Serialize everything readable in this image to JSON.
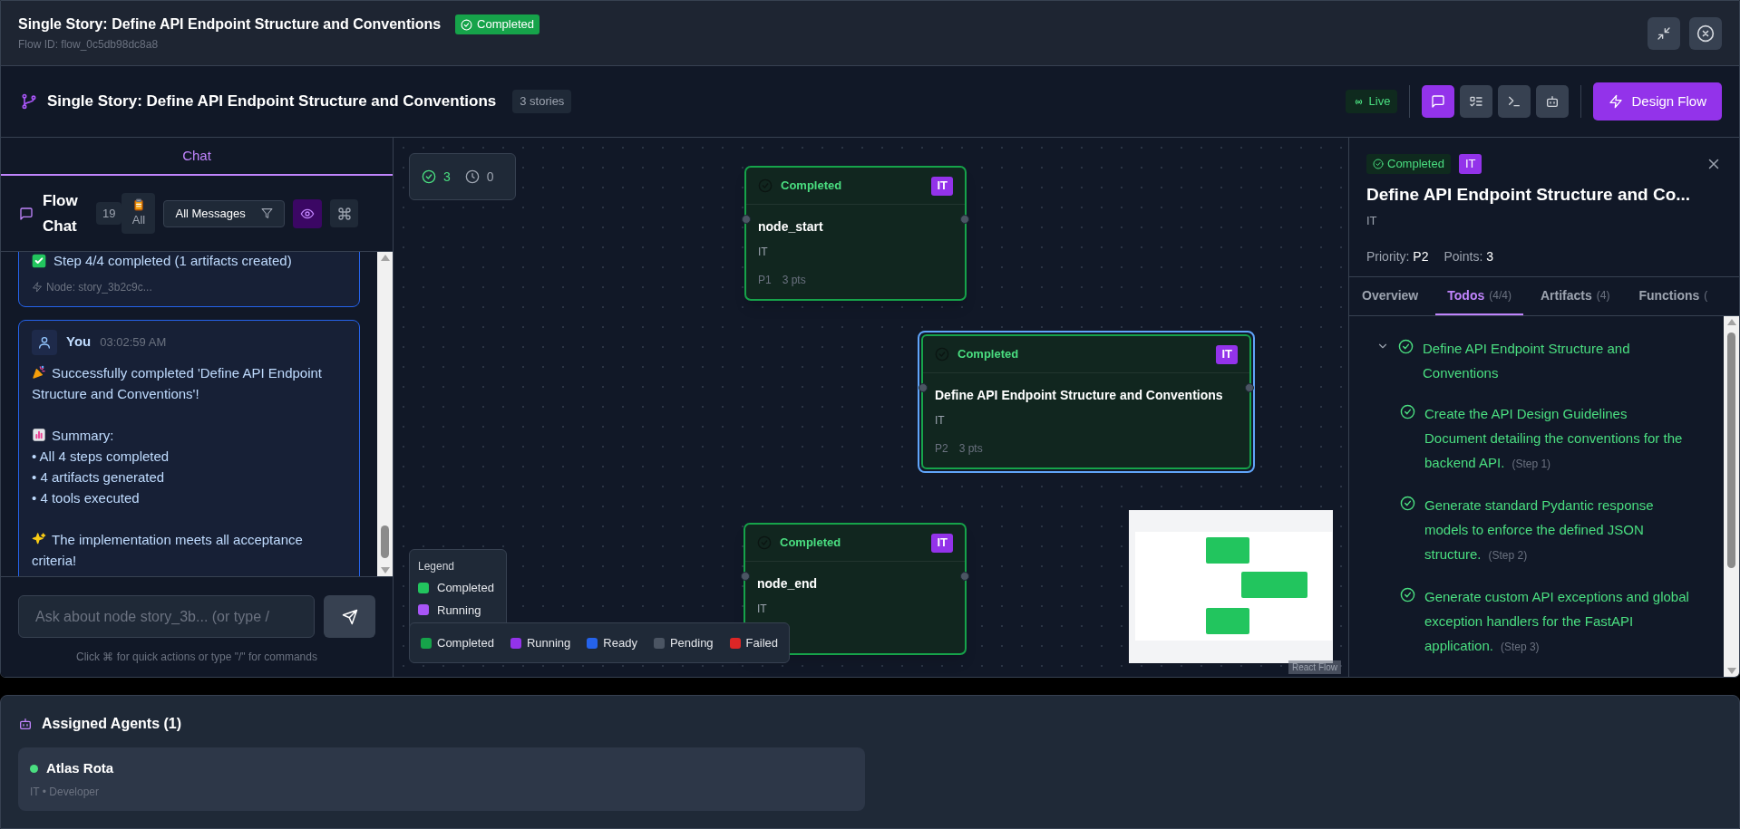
{
  "header": {
    "title": "Single Story: Define API Endpoint Structure and Conventions",
    "flow_id": "Flow ID: flow_0c5db98dc8a8",
    "status": "Completed"
  },
  "toolbar": {
    "title": "Single Story: Define API Endpoint Structure and Conventions",
    "stories": "3 stories",
    "live": "Live",
    "views": [
      {
        "kind": "chat",
        "selected": true
      },
      {
        "kind": "todos",
        "selected": false
      },
      {
        "kind": "terminal",
        "selected": false
      },
      {
        "kind": "agent",
        "selected": false
      }
    ],
    "action": "Design Flow"
  },
  "chat": {
    "tab": "Chat",
    "title": "Flow Chat",
    "count": "19",
    "scope": "All",
    "filter": "All Messages",
    "eye_on": true,
    "messages": [
      {
        "kind": "system",
        "text": "Step 4/4 completed (1 artifacts created)",
        "node": "Node: story_3b2c9c..."
      },
      {
        "kind": "user",
        "author": "You",
        "time": "03:02:59 AM",
        "blocks": [
          {
            "kind": "party",
            "text": "Successfully completed 'Define API Endpoint Structure and Conventions'!"
          },
          {
            "kind": "gap"
          },
          {
            "kind": "chart",
            "text": "Summary:"
          },
          {
            "kind": "plain",
            "text": "• All 4 steps completed"
          },
          {
            "kind": "plain",
            "text": "• 4 artifacts generated"
          },
          {
            "kind": "plain",
            "text": "• 4 tools executed"
          },
          {
            "kind": "gap"
          },
          {
            "kind": "sparkles",
            "text": "The implementation meets all acceptance criteria!"
          }
        ]
      }
    ],
    "placeholder": "Ask about node story_3b... (or type /",
    "hint": "Click ⌘ for quick actions or type \"/\" for commands"
  },
  "canvas": {
    "stats": {
      "done": "3",
      "waiting": "0"
    },
    "nodes": [
      {
        "status": "Completed",
        "badge": "IT",
        "name": "node_start",
        "team": "IT",
        "priority": "P1",
        "points": "3 pts",
        "selected": false
      },
      {
        "status": "Completed",
        "badge": "IT",
        "name": "Define API Endpoint Structure and Conventions",
        "team": "IT",
        "priority": "P2",
        "points": "3 pts",
        "selected": true
      },
      {
        "status": "Completed",
        "badge": "IT",
        "name": "node_end",
        "team": "IT",
        "selected": false
      }
    ],
    "legend": {
      "title": "Legend",
      "items": [
        {
          "label": "Completed",
          "color": "#22c55e"
        },
        {
          "label": "Running",
          "color": "#a855f7"
        }
      ]
    },
    "status_bar": [
      {
        "label": "Completed",
        "color": "#16a34a"
      },
      {
        "label": "Running",
        "color": "#9333ea"
      },
      {
        "label": "Ready",
        "color": "#2563eb"
      },
      {
        "label": "Pending",
        "color": "#4b5563"
      },
      {
        "label": "Failed",
        "color": "#dc2626"
      }
    ],
    "attribution": "React Flow"
  },
  "detail": {
    "status": "Completed",
    "badge": "IT",
    "title": "Define API Endpoint Structure and Co...",
    "team": "IT",
    "priority_label": "Priority:",
    "priority": "P2",
    "points_label": "Points:",
    "points": "3",
    "tabs": [
      {
        "label": "Overview",
        "selected": false
      },
      {
        "label": "Todos",
        "count": "(4/4)",
        "selected": true
      },
      {
        "label": "Artifacts",
        "count": "(4)",
        "selected": false
      },
      {
        "label": "Functions",
        "count": "(",
        "selected": false
      }
    ],
    "todos": [
      {
        "text": "Define API Endpoint Structure and Conventions",
        "done": true,
        "expanded": true,
        "children": [
          {
            "text": "Create the API Design Guidelines Document detailing the conventions for the backend API.",
            "step": "(Step 1)",
            "done": true
          },
          {
            "text": "Generate standard Pydantic response models to enforce the defined JSON structure.",
            "step": "(Step 2)",
            "done": true
          },
          {
            "text": "Generate custom API exceptions and global exception handlers for the FastAPI application.",
            "step": "(Step 3)",
            "done": true
          }
        ]
      }
    ]
  },
  "agents": {
    "title": "Assigned Agents (1)",
    "items": [
      {
        "name": "Atlas Rota",
        "role": "IT • Developer",
        "online": true
      }
    ]
  }
}
